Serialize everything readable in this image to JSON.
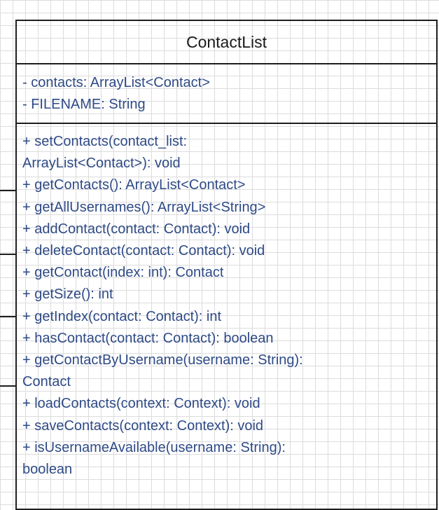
{
  "class_name": "ContactList",
  "attributes": [
    "- contacts: ArrayList<Contact>",
    "- FILENAME: String"
  ],
  "methods": [
    "+ setContacts(contact_list:",
    "ArrayList<Contact>): void",
    "+ getContacts(): ArrayList<Contact>",
    "+ getAllUsernames(): ArrayList<String>",
    "+ addContact(contact: Contact): void",
    "+ deleteContact(contact: Contact): void",
    "+ getContact(index: int):  Contact",
    "+ getSize(): int",
    "+ getIndex(contact: Contact): int",
    "+ hasContact(contact: Contact): boolean",
    "+ getContactByUsername(username: String):",
    "Contact",
    "+ loadContacts(context: Context): void",
    "+ saveContacts(context: Context): void",
    "+ isUsernameAvailable(username: String):",
    "boolean"
  ],
  "colors": {
    "member_text": "#2e4a86",
    "border": "#1e1e1e",
    "grid": "#dcdcdc"
  }
}
